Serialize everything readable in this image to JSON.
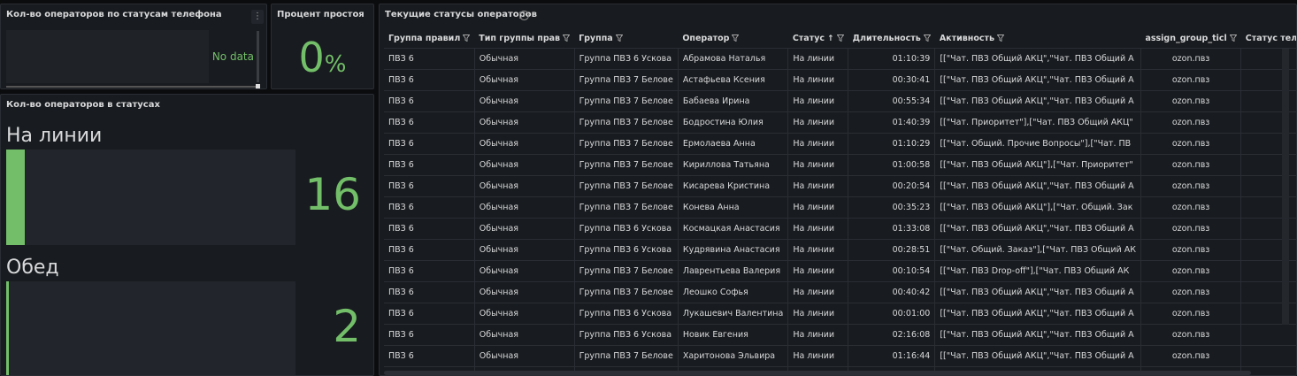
{
  "panels": {
    "phone_status": {
      "title": "Кол-во операторов по статусам телефона",
      "menu_icon": "kebab-icon",
      "no_data": "No data"
    },
    "idle_percent": {
      "title": "Процент простоя",
      "value": "0",
      "unit": "%"
    },
    "status_counts": {
      "title": "Кол-во операторов в статусах",
      "items": [
        {
          "label": "На линии",
          "value": "16",
          "fill": 0.065
        },
        {
          "label": "Обед",
          "value": "2",
          "fill": 0.008
        }
      ]
    },
    "current_statuses": {
      "title": "Текущие статусы операторов",
      "info_icon": "info-icon",
      "headers": [
        "Группа правил",
        "Тип группы прав",
        "Группа",
        "Оператор",
        "Статус",
        "Длительность",
        "Активность",
        "assign_group_ticl",
        "Статус теле"
      ],
      "rows": [
        [
          "ПВЗ 6",
          "Обычная",
          "Группа ПВЗ 6 Ускова",
          "Абрамова Наталья",
          "На линии",
          "01:10:39",
          "[[\"Чат. ПВЗ Общий АКЦ\",\"Чат. ПВЗ Общий А",
          "ozon.пвз"
        ],
        [
          "ПВЗ 6",
          "Обычная",
          "Группа ПВЗ 7 Белове",
          "Астафьева Ксения",
          "На линии",
          "00:30:41",
          "[[\"Чат. ПВЗ Общий АКЦ\",\"Чат. ПВЗ Общий А",
          "ozon.пвз"
        ],
        [
          "ПВЗ 6",
          "Обычная",
          "Группа ПВЗ 7 Белове",
          "Бабаева Ирина",
          "На линии",
          "00:55:34",
          "[[\"Чат. ПВЗ Общий АКЦ\",\"Чат. ПВЗ Общий А",
          "ozon.пвз"
        ],
        [
          "ПВЗ 6",
          "Обычная",
          "Группа ПВЗ 7 Белове",
          "Бодростина Юлия",
          "На линии",
          "01:40:39",
          "[[\"Чат. Приоритет\"],[\"Чат. ПВЗ Общий АКЦ\"",
          "ozon.пвз"
        ],
        [
          "ПВЗ 6",
          "Обычная",
          "Группа ПВЗ 7 Белове",
          "Ермолаева Анна",
          "На линии",
          "01:10:29",
          "[[\"Чат. Общий. Прочие Вопросы\"],[\"Чат. ПВ",
          "ozon.пвз"
        ],
        [
          "ПВЗ 6",
          "Обычная",
          "Группа ПВЗ 7 Белове",
          "Кириллова Татьяна",
          "На линии",
          "01:00:58",
          "[[\"Чат. ПВЗ Общий АКЦ\"],[\"Чат. Приоритет\"",
          "ozon.пвз"
        ],
        [
          "ПВЗ 6",
          "Обычная",
          "Группа ПВЗ 7 Белове",
          "Кисарева Кристина",
          "На линии",
          "00:20:54",
          "[[\"Чат. ПВЗ Общий АКЦ\",\"Чат. ПВЗ Общий А",
          "ozon.пвз"
        ],
        [
          "ПВЗ 6",
          "Обычная",
          "Группа ПВЗ 7 Белове",
          "Конева Анна",
          "На линии",
          "00:35:23",
          "[[\"Чат. ПВЗ Общий АКЦ\"],[\"Чат. Общий. Зак",
          "ozon.пвз"
        ],
        [
          "ПВЗ 6",
          "Обычная",
          "Группа ПВЗ 6 Ускова",
          "Космацкая Анастасия",
          "На линии",
          "01:33:08",
          "[[\"Чат. ПВЗ Общий АКЦ\",\"Чат. ПВЗ Общий А",
          "ozon.пвз"
        ],
        [
          "ПВЗ 6",
          "Обычная",
          "Группа ПВЗ 6 Ускова",
          "Кудрявина Анастасия",
          "На линии",
          "00:28:51",
          "[[\"Чат. Общий. Заказ\"],[\"Чат. ПВЗ Общий АК",
          "ozon.пвз"
        ],
        [
          "ПВЗ 6",
          "Обычная",
          "Группа ПВЗ 7 Белове",
          "Лаврентьева Валерия",
          "На линии",
          "00:10:54",
          "[[\"Чат. ПВЗ Drop-off\"],[\"Чат. ПВЗ Общий АК",
          "ozon.пвз"
        ],
        [
          "ПВЗ 6",
          "Обычная",
          "Группа ПВЗ 7 Белове",
          "Леошко Софья",
          "На линии",
          "00:40:42",
          "[[\"Чат. ПВЗ Общий АКЦ\",\"Чат. ПВЗ Общий А",
          "ozon.пвз"
        ],
        [
          "ПВЗ 6",
          "Обычная",
          "Группа ПВЗ 6 Ускова",
          "Лукашевич Валентина",
          "На линии",
          "00:01:00",
          "[[\"Чат. ПВЗ Общий АКЦ\",\"Чат. ПВЗ Общий А",
          "ozon.пвз"
        ],
        [
          "ПВЗ 6",
          "Обычная",
          "Группа ПВЗ 6 Ускова",
          "Новик Евгения",
          "На линии",
          "02:16:08",
          "[[\"Чат. ПВЗ Общий АКЦ\",\"Чат. ПВЗ Общий А",
          "ozon.пвз"
        ],
        [
          "ПВЗ 6",
          "Обычная",
          "Группа ПВЗ 7 Белове",
          "Харитонова Эльвира",
          "На линии",
          "01:16:44",
          "[[\"Чат. ПВЗ Общий АКЦ\",\"Чат. ПВЗ Общий А",
          "ozon.пвз"
        ],
        [
          "",
          "",
          "",
          "",
          "",
          "",
          "",
          ""
        ]
      ]
    }
  },
  "colors": {
    "accent_green": "#73bf69",
    "panel_bg": "#181b1f",
    "page_bg": "#0b0c0e"
  }
}
